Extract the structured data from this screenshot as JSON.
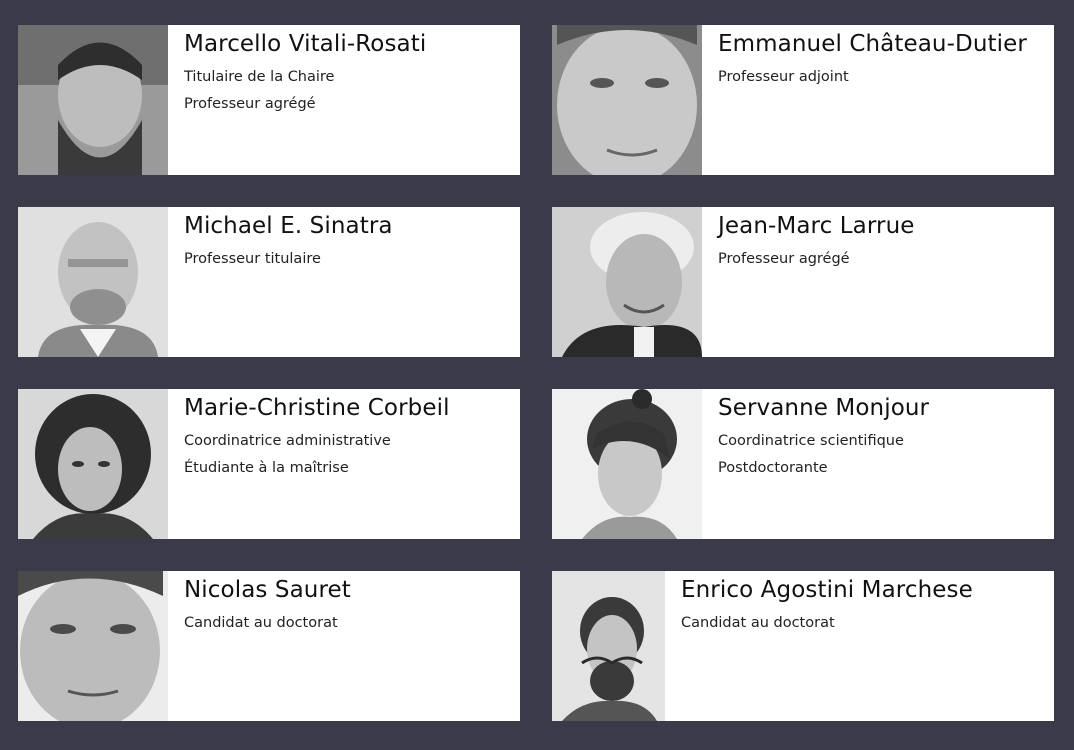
{
  "people": [
    {
      "name": "Marcello Vitali-Rosati",
      "roles": [
        "Titulaire de la Chaire",
        "Professeur agrégé"
      ],
      "photo_icon": "portrait-photo"
    },
    {
      "name": "Emmanuel Château-Dutier",
      "roles": [
        "Professeur adjoint"
      ],
      "photo_icon": "portrait-photo"
    },
    {
      "name": "Michael E. Sinatra",
      "roles": [
        "Professeur titulaire"
      ],
      "photo_icon": "portrait-photo"
    },
    {
      "name": "Jean-Marc Larrue",
      "roles": [
        "Professeur agrégé"
      ],
      "photo_icon": "portrait-photo"
    },
    {
      "name": "Marie-Christine Corbeil",
      "roles": [
        "Coordinatrice administrative",
        "Étudiante à la maîtrise"
      ],
      "photo_icon": "portrait-photo"
    },
    {
      "name": "Servanne Monjour",
      "roles": [
        "Coordinatrice scientifique",
        "Postdoctorante"
      ],
      "photo_icon": "portrait-photo"
    },
    {
      "name": "Nicolas Sauret",
      "roles": [
        "Candidat au doctorat"
      ],
      "photo_icon": "portrait-photo"
    },
    {
      "name": "Enrico Agostini Marchese",
      "roles": [
        "Candidat au doctorat"
      ],
      "photo_icon": "portrait-photo"
    }
  ],
  "colors": {
    "background": "#3a3a48",
    "card": "#ffffff",
    "text": "#111111"
  }
}
